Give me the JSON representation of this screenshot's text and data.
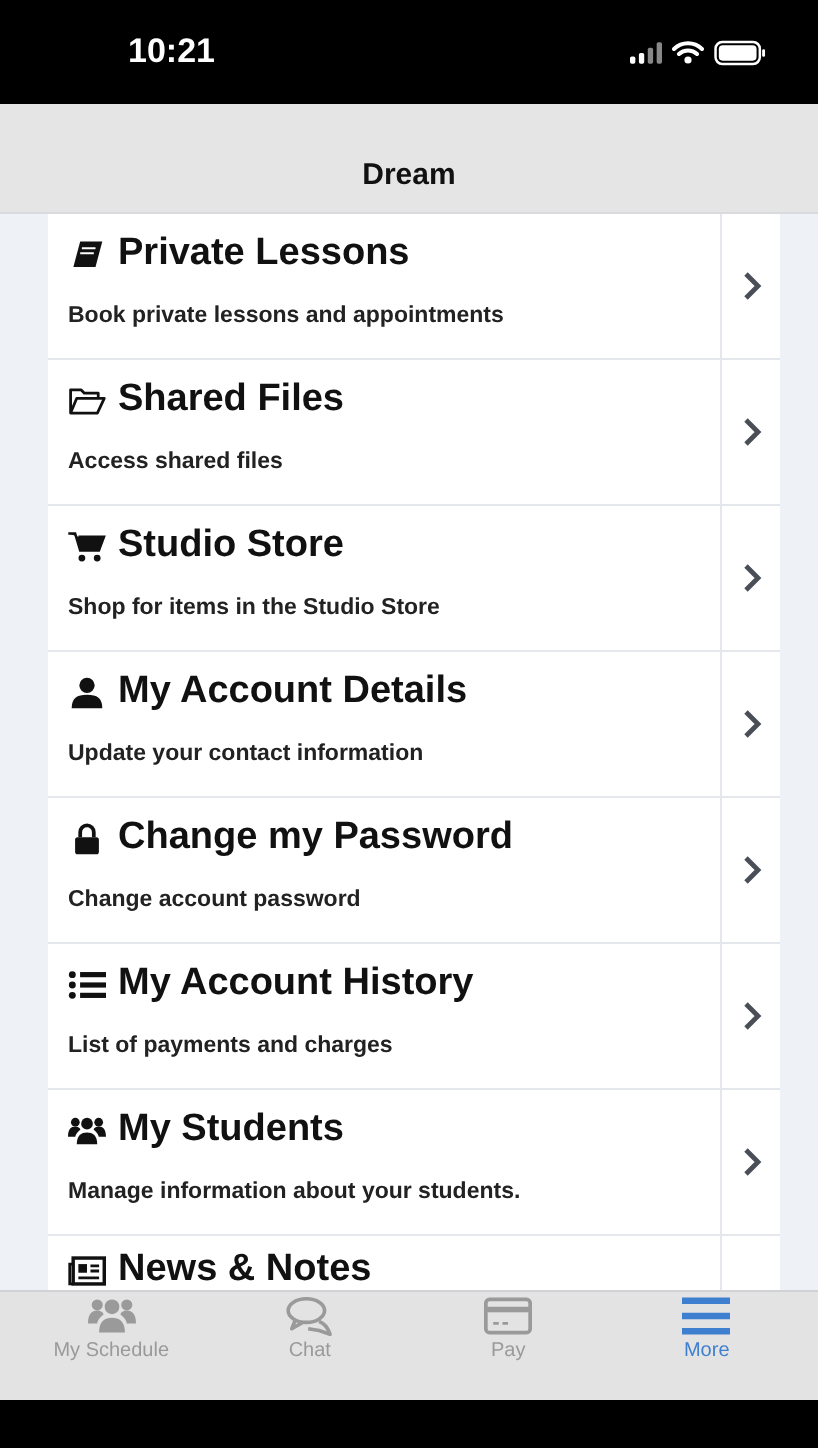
{
  "status_bar": {
    "time": "10:21"
  },
  "header": {
    "title": "Dream"
  },
  "menu": [
    {
      "kind": "book",
      "title": "Private Lessons",
      "subtitle": "Book private lessons and appointments"
    },
    {
      "kind": "folder",
      "title": "Shared Files",
      "subtitle": "Access shared files"
    },
    {
      "kind": "cart",
      "title": "Studio Store",
      "subtitle": "Shop for items in the Studio Store"
    },
    {
      "kind": "user",
      "title": "My Account Details",
      "subtitle": "Update your contact information"
    },
    {
      "kind": "lock",
      "title": "Change my Password",
      "subtitle": "Change account password"
    },
    {
      "kind": "list",
      "title": "My Account History",
      "subtitle": "List of payments and charges"
    },
    {
      "kind": "users",
      "title": "My Students",
      "subtitle": "Manage information about your students."
    }
  ],
  "partial_item": {
    "kind": "news",
    "title": "News & Notes"
  },
  "tab_bar": [
    {
      "kind": "users",
      "label": "My Schedule",
      "selected": false
    },
    {
      "kind": "chat",
      "label": "Chat",
      "selected": false
    },
    {
      "kind": "card",
      "label": "Pay",
      "selected": false
    },
    {
      "kind": "menu",
      "label": "More",
      "selected": true
    }
  ]
}
